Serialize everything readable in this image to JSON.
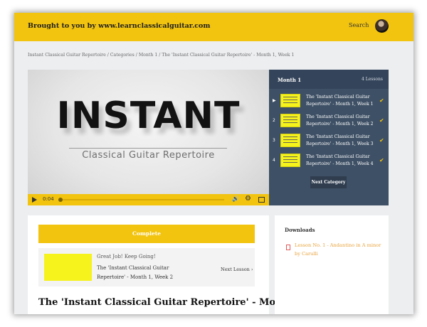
{
  "header": {
    "brand": "Brought to you by www.learnclassicalguitar.com",
    "search_label": "Search"
  },
  "breadcrumb": "Instant Classical Guitar Repertoire / Categories / Month 1 / The 'Instant Classical Guitar Repertoire' - Month 1, Week 1",
  "video": {
    "title": "INSTANT",
    "subtitle": "Classical Guitar Repertoire",
    "time": "0:04",
    "progress": 0.0
  },
  "panel": {
    "title": "Month 1",
    "count": "4 Lessons",
    "lessons": [
      {
        "num": "1",
        "title": "The 'Instant Classical Guitar Repertoire' - Month 1, Week 1",
        "completed": true,
        "active": true
      },
      {
        "num": "2",
        "title": "The 'Instant Classical Guitar Repertoire' - Month 1, Week 2",
        "completed": true,
        "active": false
      },
      {
        "num": "3",
        "title": "The 'Instant Classical Guitar Repertoire' - Month 1, Week 3",
        "completed": true,
        "active": false
      },
      {
        "num": "4",
        "title": "The 'Instant Classical Guitar Repertoire' - Month 1, Week 4",
        "completed": true,
        "active": false
      }
    ],
    "next_category": "Next Category"
  },
  "main": {
    "complete_label": "Complete",
    "great_job": "Great Job! Keep Going!",
    "next_title": "The 'Instant Classical Guitar Repertoire' - Month 1, Week 2",
    "next_label": "Next Lesson",
    "heading": "The 'Instant Classical Guitar Repertoire' - Month"
  },
  "downloads": {
    "title": "Downloads",
    "link": "Lesson No. 1 - Andantino in A minor by Carulli"
  },
  "colors": {
    "accent": "#f2c40f",
    "panel": "#3e5065",
    "link": "#e8a33c"
  }
}
